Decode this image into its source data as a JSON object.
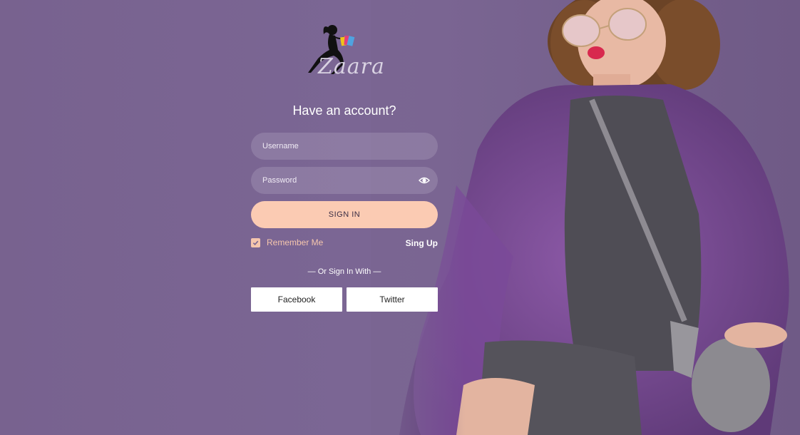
{
  "brand": {
    "logo_text": "Zaara",
    "logo_icon": "woman-with-shopping-bags-icon"
  },
  "login": {
    "heading": "Have an account?",
    "username_placeholder": "Username",
    "password_placeholder": "Password",
    "password_toggle_icon": "eye-icon",
    "signin_label": "SIGN IN",
    "remember_label": "Remember Me",
    "remember_checked": true,
    "signup_label": "Sing Up",
    "divider_text": "— Or Sign In With —",
    "social": {
      "facebook_label": "Facebook",
      "twitter_label": "Twitter"
    }
  },
  "colors": {
    "background": "#7a6592",
    "accent": "#fbcbb3",
    "accent_text": "#f5c6ad",
    "field_bg": "rgba(255,255,255,0.14)"
  }
}
